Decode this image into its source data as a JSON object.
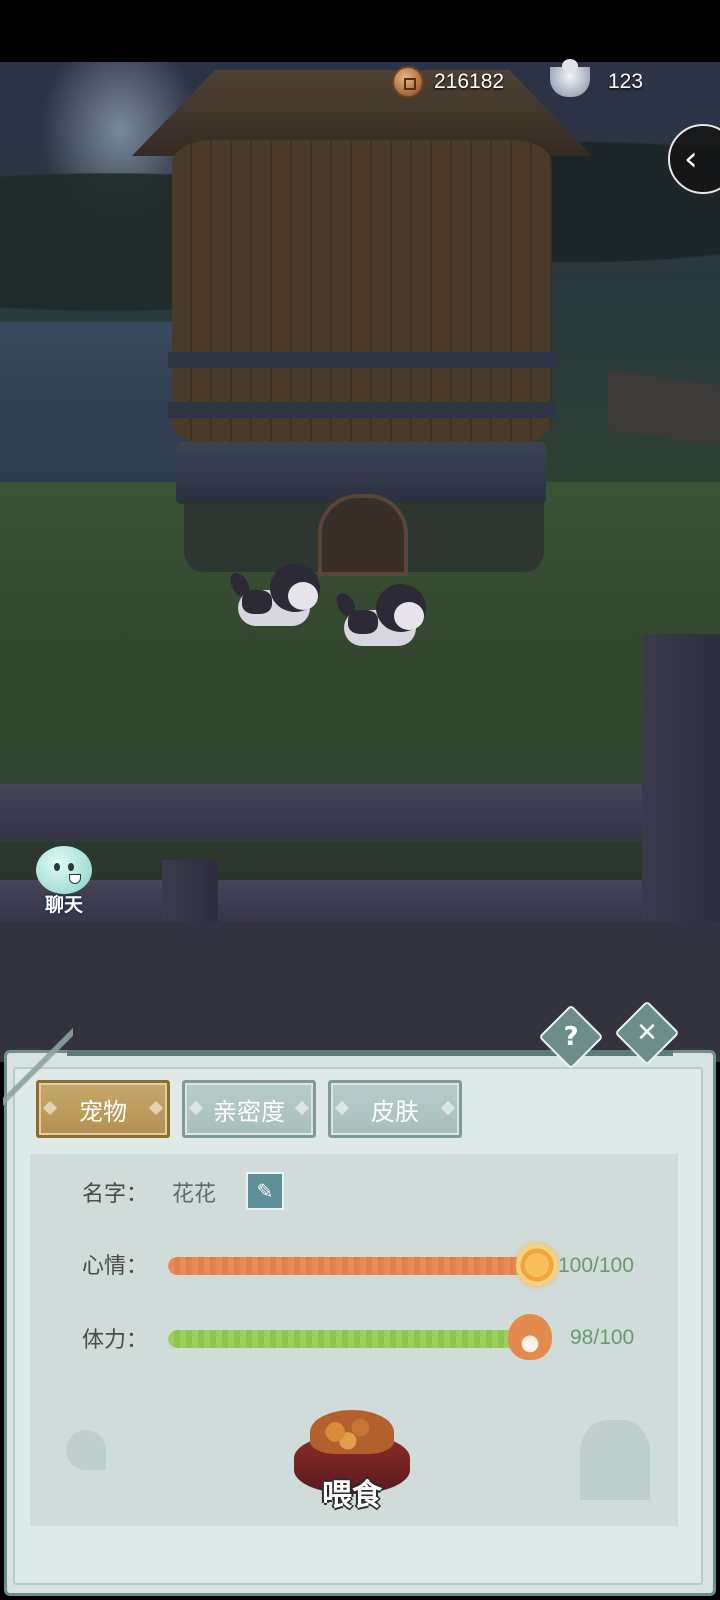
{
  "currency": {
    "coins": {
      "value": "216182",
      "icon": "copper-coin-icon"
    },
    "silver": {
      "value": "123",
      "icon": "silver-ingot-icon"
    }
  },
  "scene": {
    "back_button_icon": "chevron-left-icon",
    "chat": {
      "label": "聊天",
      "icon": "chat-spirit-icon"
    }
  },
  "panel": {
    "help_icon": "?",
    "close_icon": "✕",
    "tabs": [
      {
        "label": "宠物",
        "active": true
      },
      {
        "label": "亲密度",
        "active": false
      },
      {
        "label": "皮肤",
        "active": false
      }
    ],
    "name": {
      "label": "名字：",
      "value": "花花",
      "edit_icon": "pencil-icon"
    },
    "mood": {
      "label": "心情：",
      "value_text": "100/100",
      "current": 100,
      "max": 100,
      "color": "#e98a58",
      "icon": "sun-icon"
    },
    "stamina": {
      "label": "体力：",
      "value_text": "98/100",
      "current": 98,
      "max": 100,
      "color": "#9bcf5e",
      "icon": "paw-icon"
    },
    "feed_button": {
      "label": "喂食",
      "icon": "pet-food-bowl-icon"
    }
  }
}
